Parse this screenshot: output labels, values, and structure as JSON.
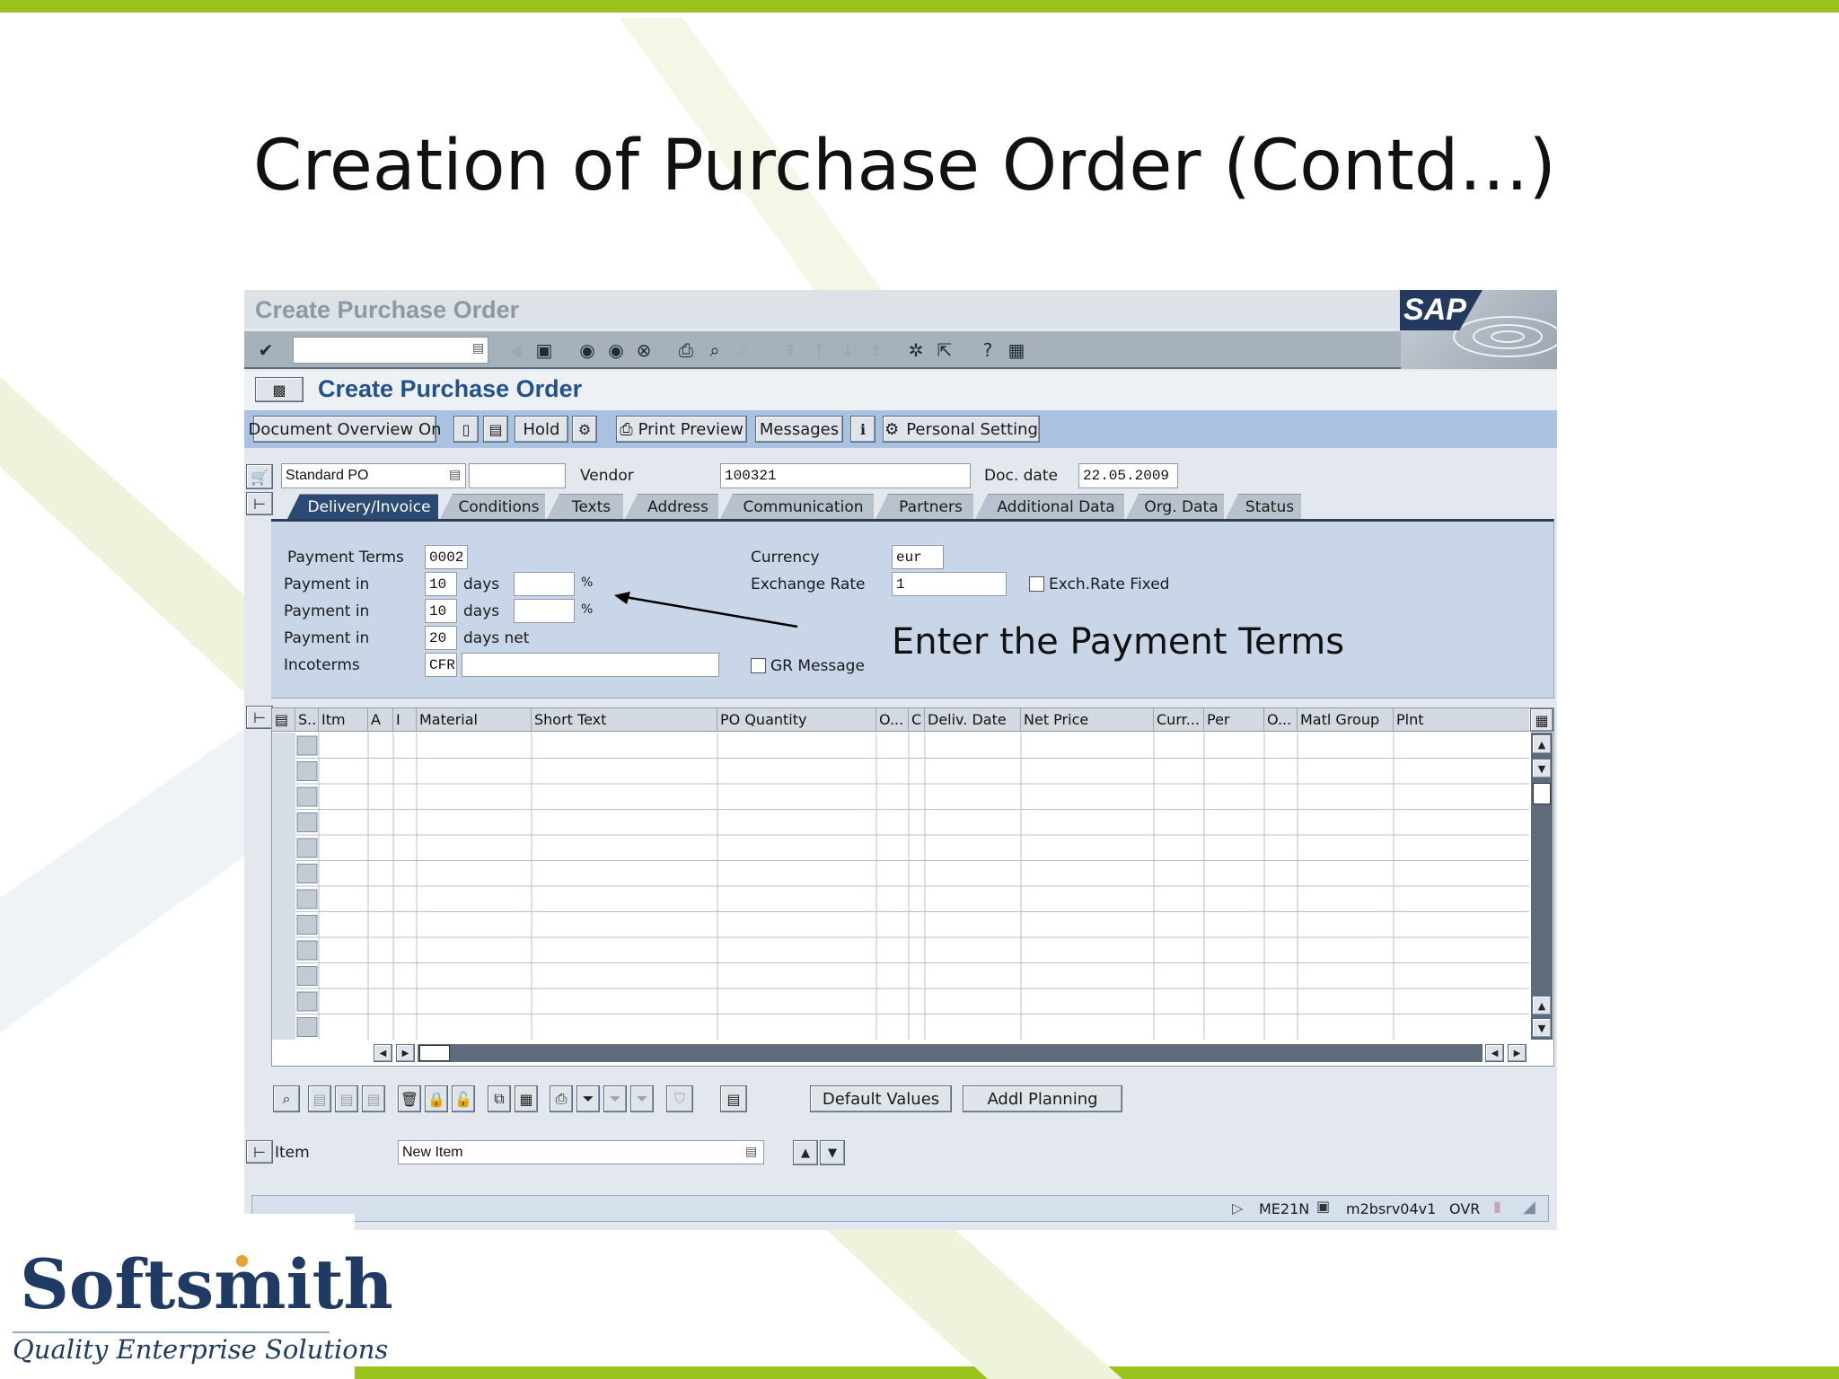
{
  "slide": {
    "title": "Creation of Purchase Order (Contd…)",
    "callout": "Enter the Payment Terms",
    "brand": {
      "name": "Softsmith",
      "tagline": "Quality Enterprise Solutions"
    },
    "accent": "#9ac31c"
  },
  "window": {
    "title": "Create Purchase Order",
    "logo": "SAP",
    "command_field": "",
    "screen_title": "Create Purchase Order"
  },
  "app_toolbar": {
    "document_overview": "Document Overview On",
    "hold": "Hold",
    "print_preview": "Print Preview",
    "messages": "Messages",
    "personal_setting": "Personal Setting"
  },
  "header": {
    "doc_type": "Standard PO",
    "po_number": "",
    "vendor_label": "Vendor",
    "vendor": "100321",
    "doc_date_label": "Doc. date",
    "doc_date": "22.05.2009"
  },
  "tabs": [
    "Delivery/Invoice",
    "Conditions",
    "Texts",
    "Address",
    "Communication",
    "Partners",
    "Additional Data",
    "Org. Data",
    "Status"
  ],
  "delivery_invoice": {
    "payment_terms_label": "Payment Terms",
    "payment_terms": "0002",
    "payment_in_label": "Payment in",
    "payment_rows": [
      {
        "days": "10",
        "unit": "days",
        "pct": "",
        "pct_sign": "%"
      },
      {
        "days": "10",
        "unit": "days",
        "pct": "",
        "pct_sign": "%"
      },
      {
        "days": "20",
        "unit": "days net"
      }
    ],
    "incoterms_label": "Incoterms",
    "incoterms": "CFR",
    "incoterms_text": "",
    "currency_label": "Currency",
    "currency": "eur",
    "exchange_rate_label": "Exchange Rate",
    "exchange_rate": "1",
    "exch_rate_fixed": "Exch.Rate Fixed",
    "gr_message": "GR Message"
  },
  "items_table": {
    "columns": [
      "S..",
      "Itm",
      "A",
      "I",
      "Material",
      "Short Text",
      "PO Quantity",
      "O...",
      "C",
      "Deliv. Date",
      "Net Price",
      "Curr...",
      "Per",
      "O...",
      "Matl Group",
      "Plnt"
    ],
    "row_count": 12
  },
  "bottom_toolbar": {
    "default_values": "Default Values",
    "addl_planning": "Addl Planning"
  },
  "item_selector": {
    "label": "Item",
    "value": "New Item"
  },
  "status_bar": {
    "transaction": "ME21N",
    "server": "m2bsrv04v1",
    "mode": "OVR"
  }
}
